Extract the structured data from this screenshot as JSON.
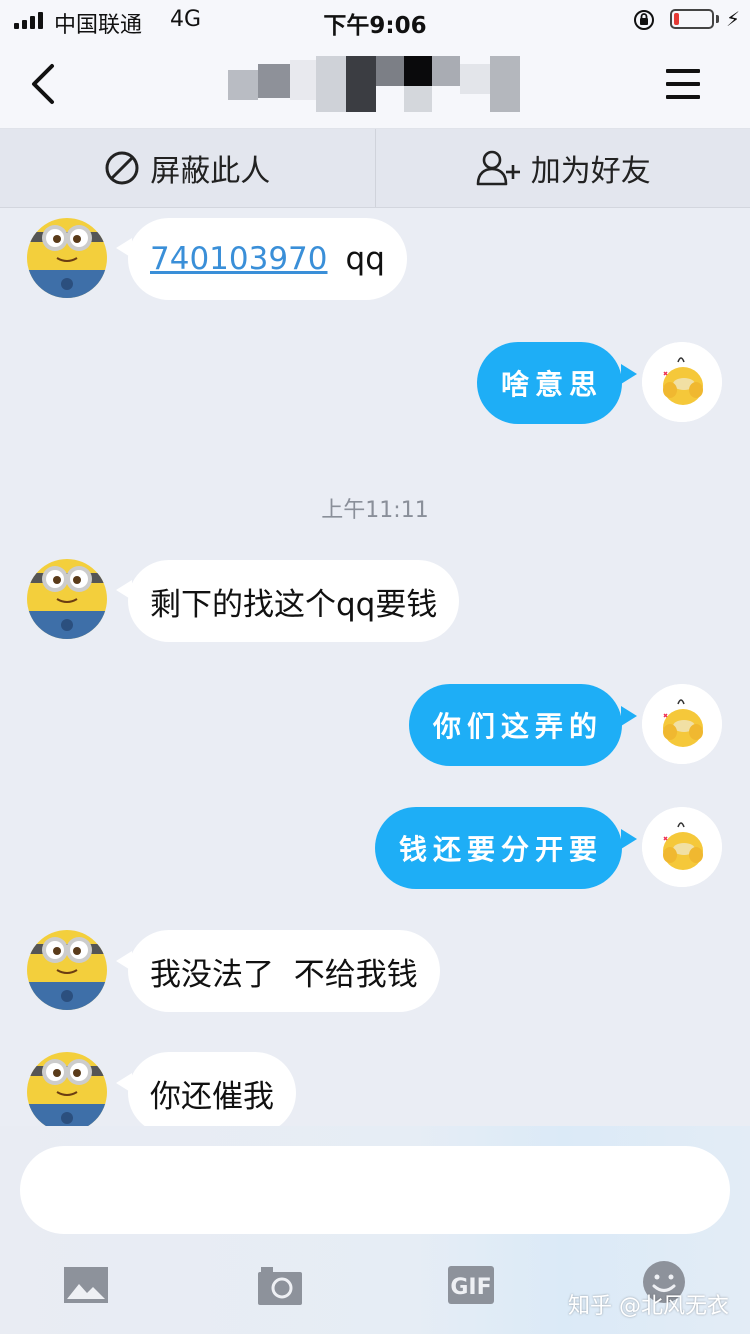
{
  "status_bar": {
    "carrier": "中国联通",
    "network": "4G",
    "time": "下午9:06",
    "battery_level": 0.15
  },
  "nav": {
    "back_icon": "chevron-left-icon",
    "menu_icon": "hamburger-menu-icon"
  },
  "actions": {
    "block": {
      "label": "屏蔽此人",
      "icon": "block-icon"
    },
    "add_friend": {
      "label": "加为好友",
      "icon": "add-user-icon"
    }
  },
  "messages": [
    {
      "side": "in",
      "qq": "740103970",
      "text": "qq"
    },
    {
      "side": "out",
      "text": "啥意思"
    },
    {
      "type": "time",
      "text": "上午11:11"
    },
    {
      "side": "in",
      "text": "剩下的找这个qq要钱"
    },
    {
      "side": "out",
      "text": "你们这弄的"
    },
    {
      "side": "out",
      "text": "钱还要分开要"
    },
    {
      "side": "in",
      "text": "我没法了  不给我钱"
    },
    {
      "side": "in",
      "text": "你还催我"
    }
  ],
  "input": {
    "value": "",
    "placeholder": ""
  },
  "toolbar": {
    "gif_label": "GIF",
    "icons": [
      "image-icon",
      "camera-icon",
      "gif-icon",
      "emoji-icon"
    ]
  },
  "watermark": "知乎 @北风无衣",
  "colors": {
    "outgoing_bubble": "#1eaef6",
    "background": "#eaedf4",
    "link": "#3a8fd8"
  }
}
